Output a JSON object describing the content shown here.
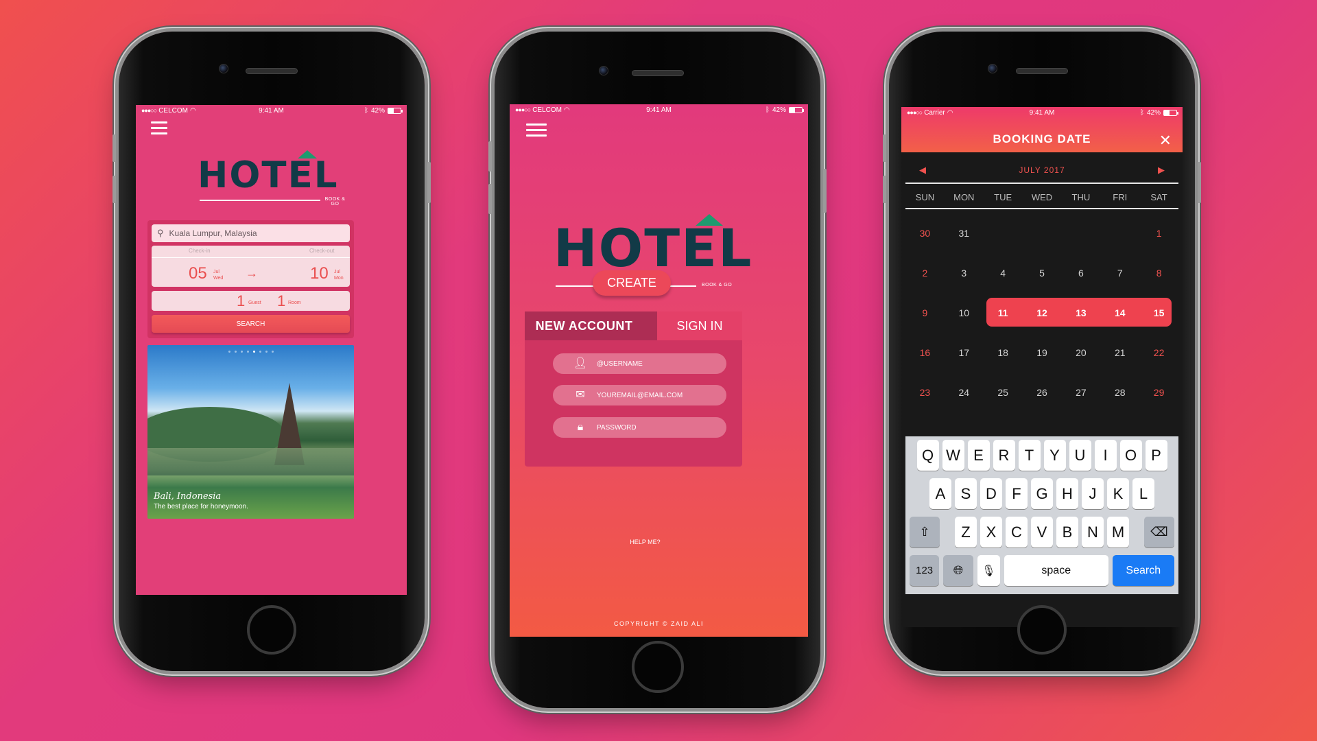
{
  "colors": {
    "accent": "#ea4f4f",
    "logo_dark": "#123a47",
    "logo_hat": "#1e9b6f",
    "keyboard_go": "#1a7bf5"
  },
  "phone1": {
    "status": {
      "carrier": "CELCOM",
      "time": "9:41 AM",
      "battery": "42%",
      "battery_level": 0.42
    },
    "logo": {
      "word": "HOTEL",
      "tagline": "BOOK & GO"
    },
    "search": {
      "value": "Kuala Lumpur, Malaysia",
      "icon": "search-icon"
    },
    "checkin": {
      "label": "Check-in",
      "day": "05",
      "month": "Jul",
      "weekday": "Wed"
    },
    "checkout": {
      "label": "Check-out",
      "day": "10",
      "month": "Jul",
      "weekday": "Mon"
    },
    "guests": {
      "count": "1",
      "label": "Guest"
    },
    "rooms": {
      "count": "1",
      "label": "Room"
    },
    "search_button": "SEARCH",
    "slider": {
      "pages": 8,
      "active_index": 4
    },
    "feature": {
      "place": "Bali, Indonesia",
      "subtitle": "The best place for honeymoon."
    }
  },
  "phone2": {
    "status": {
      "carrier": "CELCOM",
      "time": "9:41 AM",
      "battery": "42%",
      "battery_level": 0.42
    },
    "logo": {
      "word": "HOTEL",
      "tagline": "BOOK & GO"
    },
    "tabs": {
      "new_account": "NEW ACCOUNT",
      "sign_in": "SIGN IN"
    },
    "fields": {
      "username": {
        "placeholder": "@USERNAME",
        "icon": "user-icon"
      },
      "email": {
        "placeholder": "YOUREMAIL@EMAIL.COM",
        "icon": "envelope-icon"
      },
      "password": {
        "placeholder": "PASSWORD",
        "icon": "lock-icon"
      }
    },
    "create_button": "CREATE",
    "help_link": "HELP ME?",
    "copyright": "COPYRIGHT © ZAID ALI"
  },
  "phone3": {
    "status": {
      "carrier": "Carrier",
      "time": "9:41 AM",
      "battery": "42%",
      "battery_level": 0.42
    },
    "title": "BOOKING DATE",
    "close": "✕",
    "month": "JULY 2017",
    "weekdays": [
      "SUN",
      "MON",
      "TUE",
      "WED",
      "THU",
      "FRI",
      "SAT"
    ],
    "weeks": [
      [
        "30",
        "31",
        "",
        "",
        "",
        "",
        "1"
      ],
      [
        "2",
        "3",
        "4",
        "5",
        "6",
        "7",
        "8"
      ],
      [
        "9",
        "10",
        "11",
        "12",
        "13",
        "14",
        "15"
      ],
      [
        "16",
        "17",
        "18",
        "19",
        "20",
        "21",
        "22"
      ],
      [
        "23",
        "24",
        "25",
        "26",
        "27",
        "28",
        "29"
      ]
    ],
    "selected_range": [
      "11",
      "12",
      "13",
      "14",
      "15"
    ],
    "keyboard": {
      "row1": [
        "Q",
        "W",
        "E",
        "R",
        "T",
        "Y",
        "U",
        "I",
        "O",
        "P"
      ],
      "row2": [
        "A",
        "S",
        "D",
        "F",
        "G",
        "H",
        "J",
        "K",
        "L"
      ],
      "row3": [
        "Z",
        "X",
        "C",
        "V",
        "B",
        "N",
        "M"
      ],
      "numbers": "123",
      "space": "space",
      "go": "Search"
    }
  }
}
